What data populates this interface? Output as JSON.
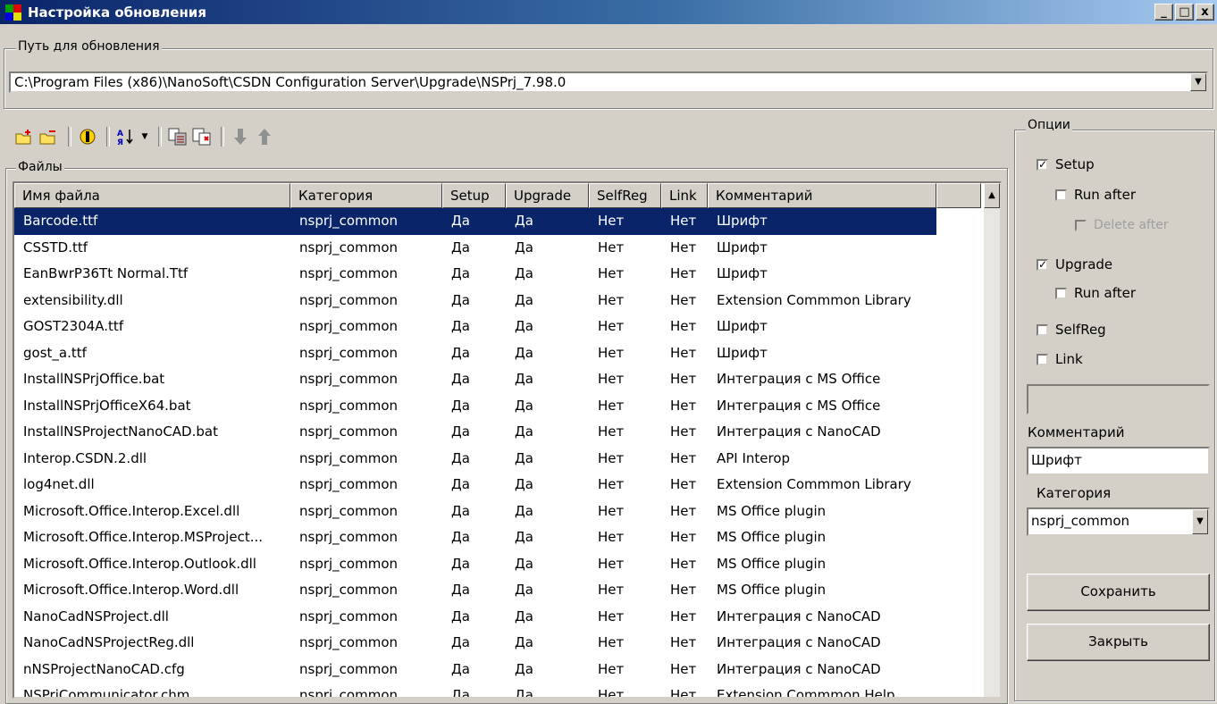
{
  "window": {
    "title": "Настройка обновления",
    "controls": {
      "minimize": "_",
      "maximize": "□",
      "close": "x"
    }
  },
  "path_group": {
    "legend": "Путь для обновления",
    "value": "C:\\Program Files (x86)\\NanoSoft\\CSDN Configuration Server\\Upgrade\\NSPrj_7.98.0"
  },
  "toolbar": {
    "icons": [
      "add-folder-icon",
      "remove-folder-icon",
      "properties-icon",
      "sort-icon",
      "dropdown-arrow-icon",
      "copy-icon",
      "paste-icon",
      "move-down-icon",
      "move-up-icon"
    ]
  },
  "files_group": {
    "legend": "Файлы",
    "columns": [
      "Имя файла",
      "Категория",
      "Setup",
      "Upgrade",
      "SelfReg",
      "Link",
      "Комментарий"
    ],
    "rows": [
      [
        "Barcode.ttf",
        "nsprj_common",
        "Да",
        "Да",
        "Нет",
        "Нет",
        "Шрифт"
      ],
      [
        "CSSTD.ttf",
        "nsprj_common",
        "Да",
        "Да",
        "Нет",
        "Нет",
        "Шрифт"
      ],
      [
        "EanBwrP36Tt Normal.Ttf",
        "nsprj_common",
        "Да",
        "Да",
        "Нет",
        "Нет",
        "Шрифт"
      ],
      [
        "extensibility.dll",
        "nsprj_common",
        "Да",
        "Да",
        "Нет",
        "Нет",
        "Extension Commmon Library"
      ],
      [
        "GOST2304A.ttf",
        "nsprj_common",
        "Да",
        "Да",
        "Нет",
        "Нет",
        "Шрифт"
      ],
      [
        "gost_a.ttf",
        "nsprj_common",
        "Да",
        "Да",
        "Нет",
        "Нет",
        "Шрифт"
      ],
      [
        "InstallNSPrjOffice.bat",
        "nsprj_common",
        "Да",
        "Да",
        "Нет",
        "Нет",
        "Интеграция с MS Office"
      ],
      [
        "InstallNSPrjOfficeX64.bat",
        "nsprj_common",
        "Да",
        "Да",
        "Нет",
        "Нет",
        "Интеграция с MS Office"
      ],
      [
        "InstallNSProjectNanoCAD.bat",
        "nsprj_common",
        "Да",
        "Да",
        "Нет",
        "Нет",
        "Интеграция с NanoCAD"
      ],
      [
        "Interop.CSDN.2.dll",
        "nsprj_common",
        "Да",
        "Да",
        "Нет",
        "Нет",
        "API Interop"
      ],
      [
        "log4net.dll",
        "nsprj_common",
        "Да",
        "Да",
        "Нет",
        "Нет",
        "Extension Commmon Library"
      ],
      [
        "Microsoft.Office.Interop.Excel.dll",
        "nsprj_common",
        "Да",
        "Да",
        "Нет",
        "Нет",
        "MS Office plugin"
      ],
      [
        "Microsoft.Office.Interop.MSProject...",
        "nsprj_common",
        "Да",
        "Да",
        "Нет",
        "Нет",
        "MS Office plugin"
      ],
      [
        "Microsoft.Office.Interop.Outlook.dll",
        "nsprj_common",
        "Да",
        "Да",
        "Нет",
        "Нет",
        "MS Office plugin"
      ],
      [
        "Microsoft.Office.Interop.Word.dll",
        "nsprj_common",
        "Да",
        "Да",
        "Нет",
        "Нет",
        "MS Office plugin"
      ],
      [
        "NanoCadNSProject.dll",
        "nsprj_common",
        "Да",
        "Да",
        "Нет",
        "Нет",
        "Интеграция с NanoCAD"
      ],
      [
        "NanoCadNSProjectReg.dll",
        "nsprj_common",
        "Да",
        "Да",
        "Нет",
        "Нет",
        "Интеграция с NanoCAD"
      ],
      [
        "nNSProjectNanoCAD.cfg",
        "nsprj_common",
        "Да",
        "Да",
        "Нет",
        "Нет",
        "Интеграция с NanoCAD"
      ],
      [
        "NSPrjCommunicator.chm",
        "nsprj_common",
        "Да",
        "Да",
        "Нет",
        "Нет",
        "Extension Commmon Help"
      ]
    ],
    "selected_row": 0
  },
  "options": {
    "legend": "Опции",
    "setup": {
      "label": "Setup",
      "checked": true
    },
    "setup_run_after": {
      "label": "Run after",
      "checked": false
    },
    "delete_after": {
      "label": "Delete after",
      "checked": false,
      "disabled": true
    },
    "upgrade": {
      "label": "Upgrade",
      "checked": true
    },
    "upgrade_run_after": {
      "label": "Run after",
      "checked": false
    },
    "selfreg": {
      "label": "SelfReg",
      "checked": false
    },
    "link": {
      "label": "Link",
      "checked": false
    },
    "blank_field": "",
    "comment_label": "Комментарий",
    "comment_value": "Шрифт",
    "category_label": "Категория",
    "category_value": "nsprj_common",
    "save_label": "Сохранить",
    "close_label": "Закрыть"
  },
  "colors": {
    "face": "#d4d0c8",
    "selection": "#0a246a",
    "title_start": "#0a246a",
    "title_end": "#a6caf0"
  }
}
